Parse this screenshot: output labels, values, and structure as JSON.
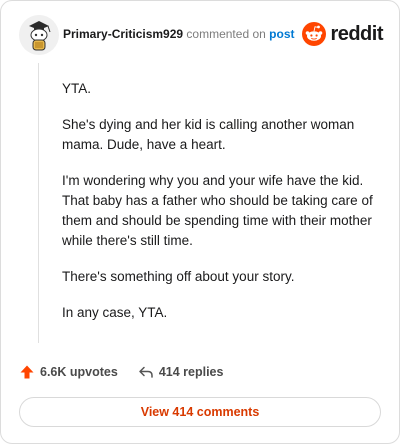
{
  "header": {
    "author": "Primary-Criticism929",
    "commented_on": "commented on",
    "post_link": "post",
    "brand": "reddit"
  },
  "comment": {
    "paragraphs": [
      "YTA.",
      "She's dying and her kid is calling another woman mama. Dude, have a heart.",
      "I'm wondering why you and your wife have the kid. That baby has a father who should be taking care of them and should be spending time with their mother while there's still time.",
      "There's something off about your story.",
      "In any case, YTA."
    ]
  },
  "actions": {
    "upvotes": "6.6K upvotes",
    "replies": "414 replies"
  },
  "footer": {
    "view_comments": "View 414 comments"
  },
  "colors": {
    "brand_orange": "#ff4500",
    "link_blue": "#0079d3",
    "cta_text": "#d93a00"
  },
  "icons": {
    "avatar": "snoo-avatar",
    "brand": "reddit-snoo-icon",
    "upvote": "upvote-arrow-icon",
    "reply": "reply-arrow-icon"
  }
}
